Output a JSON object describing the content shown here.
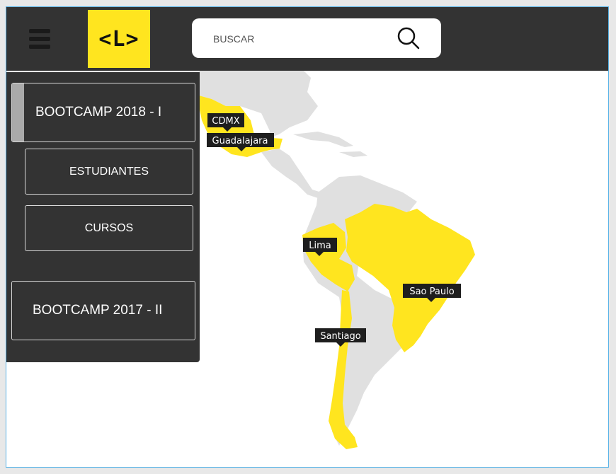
{
  "header": {
    "logo_text": "<L>",
    "search": {
      "placeholder": "BUSCAR",
      "value": ""
    }
  },
  "sidebar": {
    "items": [
      {
        "label": "BOOTCAMP 2018 - I",
        "active": true
      },
      {
        "label": "ESTUDIANTES"
      },
      {
        "label": "CURSOS"
      },
      {
        "label": "BOOTCAMP 2017 - II"
      }
    ]
  },
  "map": {
    "cities": [
      "CDMX",
      "Guadalajara",
      "Lima",
      "Sao Paulo",
      "Santiago"
    ],
    "colors": {
      "highlight": "#ffe51f",
      "land": "#e0e0e0",
      "label_bg": "#1e1e1e",
      "sea": "#ffffff"
    }
  },
  "colors": {
    "header_bg": "#333333",
    "accent": "#ffe51f",
    "frame_border": "#5ab4e8"
  }
}
